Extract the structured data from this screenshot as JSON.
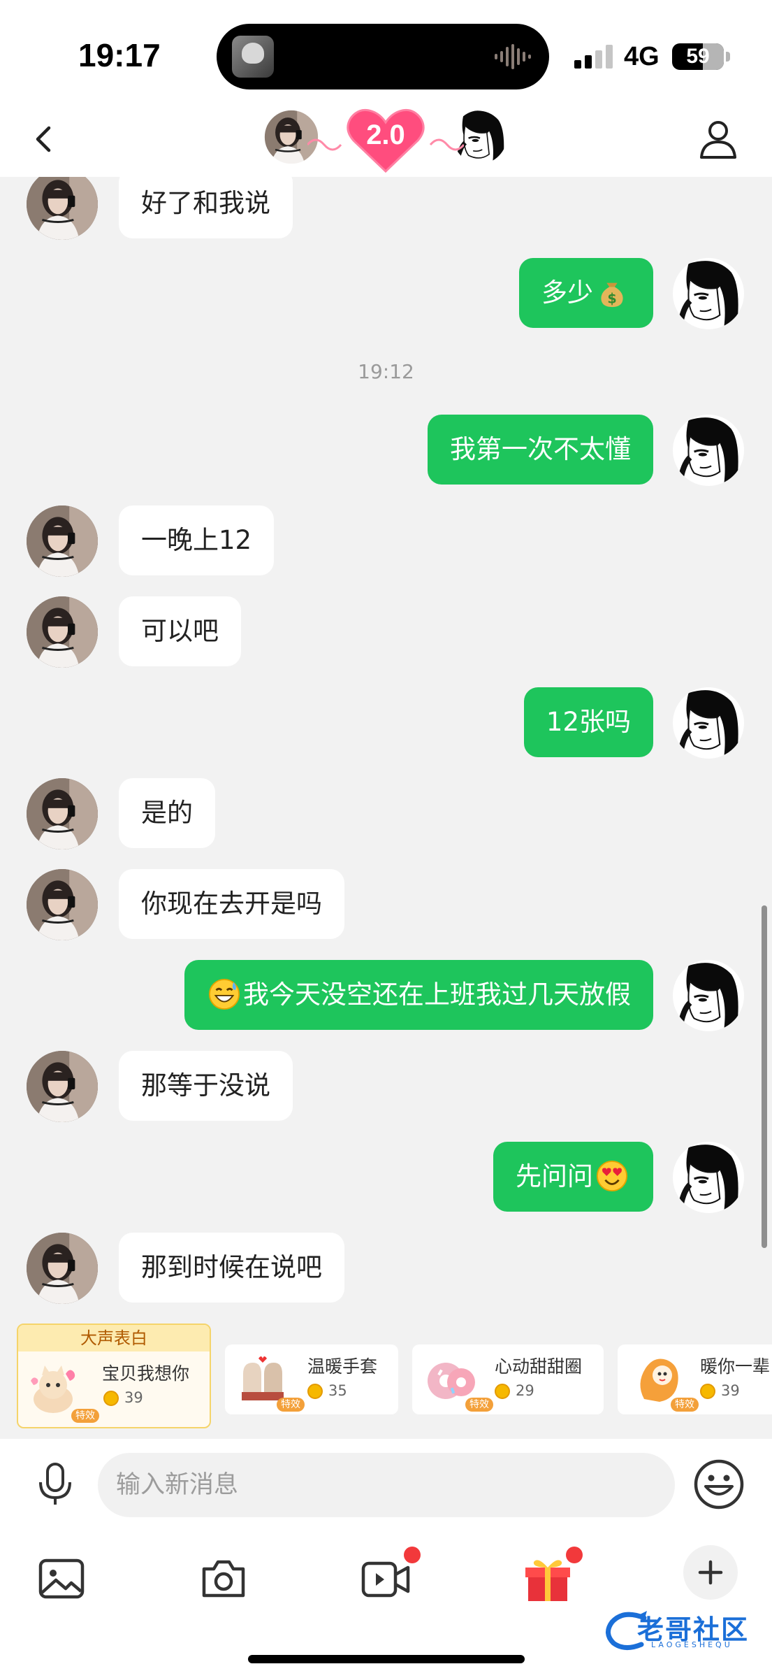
{
  "status_bar": {
    "time": "19:17",
    "network": "4G",
    "battery": "59",
    "battery_level": 59
  },
  "header": {
    "intimacy_level": "2.0"
  },
  "chat": {
    "messages": [
      {
        "side": "in",
        "text": "好了和我说"
      },
      {
        "side": "out",
        "text": "多少",
        "emoji_after": "money-bag"
      },
      {
        "type": "timestamp",
        "text": "19:12"
      },
      {
        "side": "out",
        "text": "我第一次不太懂"
      },
      {
        "side": "in",
        "text": "一晚上12"
      },
      {
        "side": "in",
        "text": "可以吧"
      },
      {
        "side": "out",
        "text": "12张吗"
      },
      {
        "side": "in",
        "text": "是的"
      },
      {
        "side": "in",
        "text": "你现在去开是吗"
      },
      {
        "side": "out",
        "text": "我今天没空还在上班我过几天放假",
        "emoji_before": "grinning-sweat"
      },
      {
        "side": "in",
        "text": "那等于没说"
      },
      {
        "side": "out",
        "text": "先问问",
        "emoji_after": "heart-eyes"
      },
      {
        "side": "in",
        "text": "那到时候在说吧"
      }
    ]
  },
  "gifts": {
    "featured_label": "大声表白",
    "effect_badge": "特效",
    "items": [
      {
        "name": "宝贝我想你",
        "price": "39",
        "icon": "cat-gift-icon"
      },
      {
        "name": "温暖手套",
        "price": "35",
        "icon": "mittens-gift-icon"
      },
      {
        "name": "心动甜甜圈",
        "price": "29",
        "icon": "donut-gift-icon"
      },
      {
        "name": "暖你一辈",
        "price": "39",
        "icon": "warmer-gift-icon"
      }
    ]
  },
  "input": {
    "placeholder": "输入新消息"
  },
  "toolbar": {
    "items": [
      "image-icon",
      "camera-icon",
      "video-call-icon",
      "gift-box-icon",
      "plus-icon"
    ]
  },
  "watermark": {
    "text": "老哥社区",
    "sub": "LAOGESHEQU"
  },
  "colors": {
    "outgoing_bubble": "#1ec55c",
    "incoming_bubble": "#ffffff",
    "background": "#f2f2f2",
    "heart": "#ff4d7e",
    "unread_dot": "#f2393b"
  }
}
